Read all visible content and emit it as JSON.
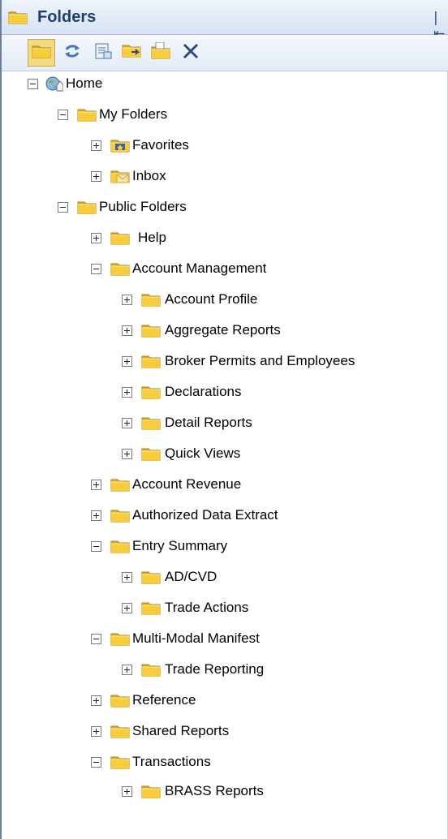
{
  "panel": {
    "title": "Folders",
    "collapse_glyph": "|⇤"
  },
  "toolbar": {
    "buttons": [
      {
        "icon": "folder-view-icon",
        "active": true
      },
      {
        "icon": "refresh-icon",
        "active": false
      },
      {
        "icon": "properties-icon",
        "active": false
      },
      {
        "icon": "move-folder-icon",
        "active": false
      },
      {
        "icon": "new-folder-icon",
        "active": false
      },
      {
        "icon": "delete-icon",
        "active": false
      }
    ]
  },
  "tree": {
    "home": "Home",
    "my_folders": "My Folders",
    "favorites": "Favorites",
    "inbox": "Inbox",
    "public_folders": "Public Folders",
    "help": "Help",
    "account_management": "Account Management",
    "account_profile": "Account Profile",
    "aggregate_reports": "Aggregate Reports",
    "broker_permits": "Broker Permits and Employees",
    "declarations": "Declarations",
    "detail_reports": "Detail Reports",
    "quick_views": "Quick Views",
    "account_revenue": "Account Revenue",
    "authorized_data_extract": "Authorized Data Extract",
    "entry_summary": "Entry Summary",
    "ad_cvd": "AD/CVD",
    "trade_actions": "Trade Actions",
    "multi_modal_manifest": "Multi-Modal Manifest",
    "trade_reporting": "Trade Reporting",
    "reference": "Reference",
    "shared_reports": "Shared Reports",
    "transactions": "Transactions",
    "brass_reports": "BRASS Reports"
  },
  "colors": {
    "folder": "#f5c431",
    "folder_dark": "#c99517",
    "title": "#1f3f6e"
  }
}
